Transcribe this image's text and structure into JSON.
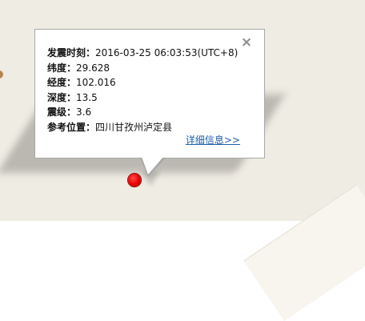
{
  "popup": {
    "close_symbol": "×",
    "fields": [
      {
        "label": "发震时刻：",
        "value": "2016-03-25 06:03:53(UTC+8)"
      },
      {
        "label": "纬度：",
        "value": "29.628"
      },
      {
        "label": "经度：",
        "value": "102.016"
      },
      {
        "label": "深度：",
        "value": "13.5"
      },
      {
        "label": "震级：",
        "value": "3.6"
      },
      {
        "label": "参考位置：",
        "value": "四川甘孜州泸定县"
      }
    ],
    "detail_link": "详细信息>>"
  },
  "map": {
    "marker_icon": "earthquake-marker-icon",
    "marker_color": "#e40000"
  }
}
